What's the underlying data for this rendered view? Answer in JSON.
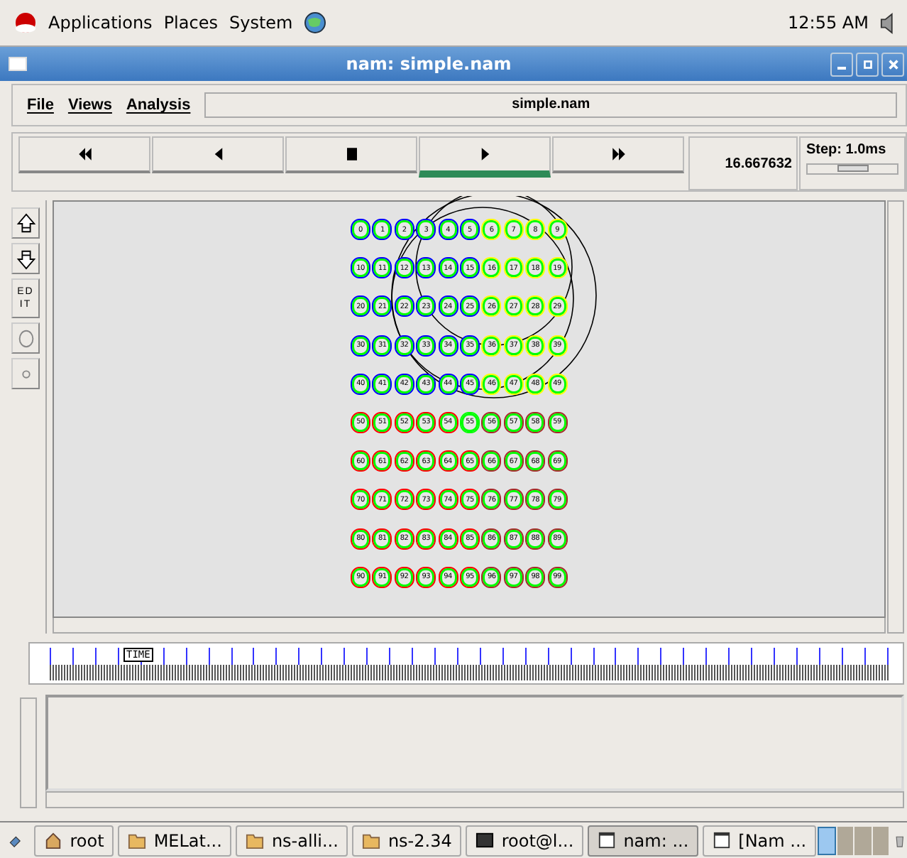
{
  "top_panel": {
    "menus": [
      "Applications",
      "Places",
      "System"
    ],
    "clock": "12:55 AM"
  },
  "window": {
    "title": "nam: simple.nam"
  },
  "menu_bar": {
    "items": [
      "File",
      "Views",
      "Analysis"
    ],
    "file_name": "simple.nam"
  },
  "controls": {
    "buttons": [
      {
        "kind": "rewind",
        "selected": false
      },
      {
        "kind": "back",
        "selected": false
      },
      {
        "kind": "stop",
        "selected": false
      },
      {
        "kind": "play",
        "selected": true
      },
      {
        "kind": "forward",
        "selected": false
      }
    ],
    "time": "16.667632",
    "step": "Step: 1.0ms",
    "step_slider": {
      "level": 0.5
    }
  },
  "side_tools": [
    {
      "kind": "zoom-in"
    },
    {
      "kind": "zoom-out"
    },
    {
      "kind": "edit",
      "label": "ED IT"
    },
    {
      "kind": "large-circle"
    },
    {
      "kind": "small-circle"
    }
  ],
  "nodes": [
    {
      "cells": [
        {
          "label": "0",
          "color": "#0000ff"
        },
        {
          "label": "1",
          "color": "#0000ff"
        },
        {
          "label": "2",
          "color": "#0000ff"
        },
        {
          "label": "3",
          "color": "#0000ff"
        },
        {
          "label": "4",
          "color": "#0000ff"
        },
        {
          "label": "5",
          "color": "#0000ff"
        },
        {
          "label": "6",
          "color": "#ffff00"
        },
        {
          "label": "7",
          "color": "#ffff00"
        },
        {
          "label": "8",
          "color": "#ffff00"
        },
        {
          "label": "9",
          "color": "#ffff00"
        }
      ]
    },
    {
      "cells": [
        {
          "label": "10",
          "color": "#0000ff"
        },
        {
          "label": "11",
          "color": "#0000ff"
        },
        {
          "label": "12",
          "color": "#0000ff"
        },
        {
          "label": "13",
          "color": "#0000ff"
        },
        {
          "label": "14",
          "color": "#0000ff"
        },
        {
          "label": "15",
          "color": "#0000ff"
        },
        {
          "label": "16",
          "color": "#ffff00"
        },
        {
          "label": "17",
          "color": "#ffff00"
        },
        {
          "label": "18",
          "color": "#ffff00"
        },
        {
          "label": "19",
          "color": "#ffff00"
        }
      ]
    },
    {
      "cells": [
        {
          "label": "20",
          "color": "#0000ff"
        },
        {
          "label": "21",
          "color": "#0000ff"
        },
        {
          "label": "22",
          "color": "#0000ff"
        },
        {
          "label": "23",
          "color": "#0000ff"
        },
        {
          "label": "24",
          "color": "#0000ff"
        },
        {
          "label": "25",
          "color": "#0000ff"
        },
        {
          "label": "26",
          "color": "#ffff00"
        },
        {
          "label": "27",
          "color": "#ffff00"
        },
        {
          "label": "28",
          "color": "#ffff00"
        },
        {
          "label": "29",
          "color": "#ffff00"
        }
      ]
    },
    {
      "cells": [
        {
          "label": "30",
          "color": "#0000ff"
        },
        {
          "label": "31",
          "color": "#0000ff"
        },
        {
          "label": "32",
          "color": "#0000ff"
        },
        {
          "label": "33",
          "color": "#0000ff"
        },
        {
          "label": "34",
          "color": "#0000ff"
        },
        {
          "label": "35",
          "color": "#0000ff"
        },
        {
          "label": "36",
          "color": "#ffff00"
        },
        {
          "label": "37",
          "color": "#ffff00"
        },
        {
          "label": "38",
          "color": "#ffff00"
        },
        {
          "label": "39",
          "color": "#ffff00"
        }
      ]
    },
    {
      "cells": [
        {
          "label": "40",
          "color": "#0000ff"
        },
        {
          "label": "41",
          "color": "#0000ff"
        },
        {
          "label": "42",
          "color": "#0000ff"
        },
        {
          "label": "43",
          "color": "#0000ff"
        },
        {
          "label": "44",
          "color": "#0000ff"
        },
        {
          "label": "45",
          "color": "#0000ff"
        },
        {
          "label": "46",
          "color": "#ffff00"
        },
        {
          "label": "47",
          "color": "#ffff00"
        },
        {
          "label": "48",
          "color": "#ffff00"
        },
        {
          "label": "49",
          "color": "#ffff00"
        }
      ]
    },
    {
      "cells": [
        {
          "label": "50",
          "color": "#ff0000"
        },
        {
          "label": "51",
          "color": "#ff0000"
        },
        {
          "label": "52",
          "color": "#ff0000"
        },
        {
          "label": "53",
          "color": "#ff0000"
        },
        {
          "label": "54",
          "color": "#ff0000"
        },
        {
          "label": "55",
          "color": "#00ff00"
        },
        {
          "label": "56",
          "color": "#a52a2a"
        },
        {
          "label": "57",
          "color": "#a52a2a"
        },
        {
          "label": "58",
          "color": "#a52a2a"
        },
        {
          "label": "59",
          "color": "#a52a2a"
        }
      ]
    },
    {
      "cells": [
        {
          "label": "60",
          "color": "#ff0000"
        },
        {
          "label": "61",
          "color": "#ff0000"
        },
        {
          "label": "62",
          "color": "#ff0000"
        },
        {
          "label": "63",
          "color": "#ff0000"
        },
        {
          "label": "64",
          "color": "#ff0000"
        },
        {
          "label": "65",
          "color": "#ff0000"
        },
        {
          "label": "66",
          "color": "#a52a2a"
        },
        {
          "label": "67",
          "color": "#a52a2a"
        },
        {
          "label": "68",
          "color": "#a52a2a"
        },
        {
          "label": "69",
          "color": "#a52a2a"
        }
      ]
    },
    {
      "cells": [
        {
          "label": "70",
          "color": "#ff0000"
        },
        {
          "label": "71",
          "color": "#ff0000"
        },
        {
          "label": "72",
          "color": "#ff0000"
        },
        {
          "label": "73",
          "color": "#ff0000"
        },
        {
          "label": "74",
          "color": "#ff0000"
        },
        {
          "label": "75",
          "color": "#ff0000"
        },
        {
          "label": "76",
          "color": "#a52a2a"
        },
        {
          "label": "77",
          "color": "#a52a2a"
        },
        {
          "label": "78",
          "color": "#a52a2a"
        },
        {
          "label": "79",
          "color": "#a52a2a"
        }
      ]
    },
    {
      "cells": [
        {
          "label": "80",
          "color": "#ff0000"
        },
        {
          "label": "81",
          "color": "#ff0000"
        },
        {
          "label": "82",
          "color": "#ff0000"
        },
        {
          "label": "83",
          "color": "#ff0000"
        },
        {
          "label": "84",
          "color": "#ff0000"
        },
        {
          "label": "85",
          "color": "#ff0000"
        },
        {
          "label": "86",
          "color": "#a52a2a"
        },
        {
          "label": "87",
          "color": "#a52a2a"
        },
        {
          "label": "88",
          "color": "#a52a2a"
        },
        {
          "label": "89",
          "color": "#a52a2a"
        }
      ]
    },
    {
      "cells": [
        {
          "label": "90",
          "color": "#ff0000"
        },
        {
          "label": "91",
          "color": "#ff0000"
        },
        {
          "label": "92",
          "color": "#ff0000"
        },
        {
          "label": "93",
          "color": "#ff0000"
        },
        {
          "label": "94",
          "color": "#ff0000"
        },
        {
          "label": "95",
          "color": "#ff0000"
        },
        {
          "label": "96",
          "color": "#a52a2a"
        },
        {
          "label": "97",
          "color": "#a52a2a"
        },
        {
          "label": "98",
          "color": "#a52a2a"
        },
        {
          "label": "99",
          "color": "#a52a2a"
        }
      ]
    }
  ],
  "timeline": {
    "marker": "TIME"
  },
  "taskbar": {
    "items": [
      {
        "label": "root",
        "kind": "home",
        "selected": false
      },
      {
        "label": "MELat...",
        "kind": "folder",
        "selected": false
      },
      {
        "label": "ns-alli...",
        "kind": "folder",
        "selected": false
      },
      {
        "label": "ns-2.34",
        "kind": "folder",
        "selected": false
      },
      {
        "label": "root@l...",
        "kind": "terminal",
        "selected": false
      },
      {
        "label": "nam: ...",
        "kind": "window",
        "selected": true
      },
      {
        "label": "[Nam ...",
        "kind": "window",
        "selected": false
      }
    ],
    "workspaces": [
      {
        "selected": true
      },
      {
        "selected": false
      },
      {
        "selected": false
      },
      {
        "selected": false
      }
    ]
  }
}
